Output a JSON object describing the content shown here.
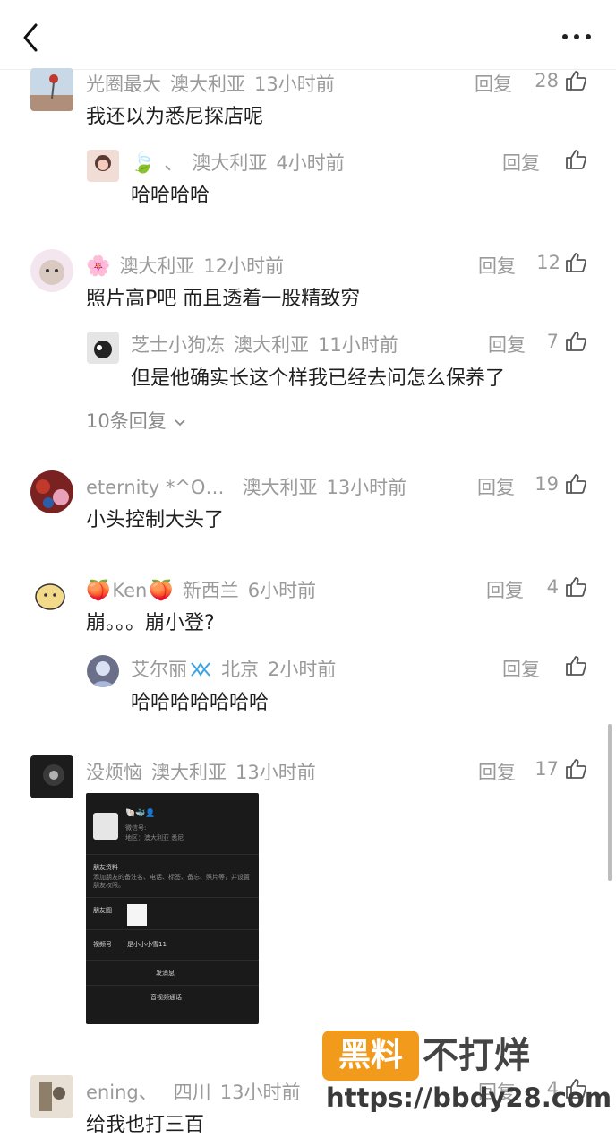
{
  "reply_label": "回复",
  "header": {
    "back_icon": "chevron-left-icon",
    "more_icon": "more-dots-icon"
  },
  "comments": [
    {
      "user": "光圈最大",
      "region": "澳大利亚",
      "time": "13小时前",
      "likes": "28",
      "text": "我还以为悉尼探店呢",
      "reply": {
        "user": "、",
        "region": "澳大利亚",
        "time": "4小时前",
        "likes": "",
        "text": "哈哈哈哈"
      }
    },
    {
      "user": "",
      "region": "澳大利亚",
      "time": "12小时前",
      "likes": "12",
      "text": "照片高P吧 而且透着一股精致穷",
      "reply": {
        "user": "芝士小狗冻",
        "region": "澳大利亚",
        "time": "11小时前",
        "likes": "7",
        "text": "但是他确实长这个样我已经去问怎么保养了"
      },
      "more_replies": "10条回复"
    },
    {
      "user": "eternity *^O…",
      "region": "澳大利亚",
      "time": "13小时前",
      "likes": "19",
      "text": "小头控制大头了"
    },
    {
      "user": "Ken",
      "region": "新西兰",
      "time": "6小时前",
      "likes": "4",
      "text": "崩。。。崩小登?",
      "reply": {
        "user": "艾尔丽",
        "region": "北京",
        "time": "2小时前",
        "likes": "",
        "text": "哈哈哈哈哈哈哈"
      }
    },
    {
      "user": "没烦恼",
      "region": "澳大利亚",
      "time": "13小时前",
      "likes": "17",
      "text": ""
    },
    {
      "user": "ening、",
      "region": "四川",
      "time": "13小时前",
      "likes": "4",
      "text": "给我也打三百"
    }
  ],
  "screenshot_card": {
    "name": "微信号:",
    "region_line": "地区：澳大利亚 悉尼",
    "friend_info_label": "朋友资料",
    "friend_info_desc": "添加朋友的备注名、电话、标签、备忘、照片等，并设置朋友权限。",
    "moments_label": "朋友圈",
    "channels_label": "视频号",
    "channels_value": "是小小小雪11",
    "send_message": "发消息",
    "video_call": "音视频通话"
  },
  "watermark": {
    "badge": "黑料",
    "title": "不打烊",
    "url": "https://bbdy28.com"
  }
}
